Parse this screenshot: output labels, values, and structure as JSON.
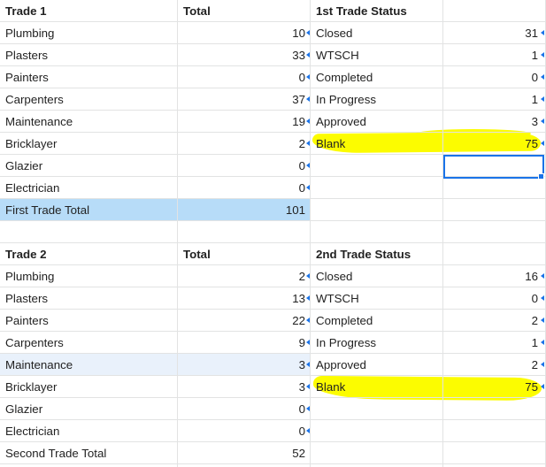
{
  "colors": {
    "total_row_fill": "#b7dcf8",
    "selected_row_fill": "#e9f1fb",
    "highlight": "#fcfc00",
    "selection_border": "#1a73e8",
    "comment_marker": "#1a73e8"
  },
  "table1": {
    "header": {
      "trade": "Trade 1",
      "total": "Total",
      "status": "1st Trade Status"
    },
    "rows": [
      {
        "trade": "Plumbing",
        "total": "10",
        "status": "Closed",
        "count": "31"
      },
      {
        "trade": "Plasters",
        "total": "33",
        "status": "WTSCH",
        "count": "1"
      },
      {
        "trade": "Painters",
        "total": "0",
        "status": "Completed",
        "count": "0"
      },
      {
        "trade": "Carpenters",
        "total": "37",
        "status": "In Progress",
        "count": "1"
      },
      {
        "trade": "Maintenance",
        "total": "19",
        "status": "Approved",
        "count": "3"
      },
      {
        "trade": "Bricklayer",
        "total": "2",
        "status": "Blank",
        "count": "75"
      },
      {
        "trade": "Glazier",
        "total": "0",
        "status": "",
        "count": ""
      },
      {
        "trade": "Electrician",
        "total": "0",
        "status": "",
        "count": ""
      }
    ],
    "total_row": {
      "label": "First Trade Total",
      "value": "101"
    }
  },
  "table2": {
    "header": {
      "trade": "Trade 2",
      "total": "Total",
      "status": "2nd Trade Status"
    },
    "rows": [
      {
        "trade": "Plumbing",
        "total": "2",
        "status": "Closed",
        "count": "16"
      },
      {
        "trade": "Plasters",
        "total": "13",
        "status": "WTSCH",
        "count": "0"
      },
      {
        "trade": "Painters",
        "total": "22",
        "status": "Completed",
        "count": "2"
      },
      {
        "trade": "Carpenters",
        "total": "9",
        "status": "In Progress",
        "count": "1"
      },
      {
        "trade": "Maintenance",
        "total": "3",
        "status": "Approved",
        "count": "2"
      },
      {
        "trade": "Bricklayer",
        "total": "3",
        "status": "Blank",
        "count": "75"
      },
      {
        "trade": "Glazier",
        "total": "0",
        "status": "",
        "count": ""
      },
      {
        "trade": "Electrician",
        "total": "0",
        "status": "",
        "count": ""
      }
    ],
    "total_row": {
      "label": "Second Trade Total",
      "value": "52"
    }
  }
}
